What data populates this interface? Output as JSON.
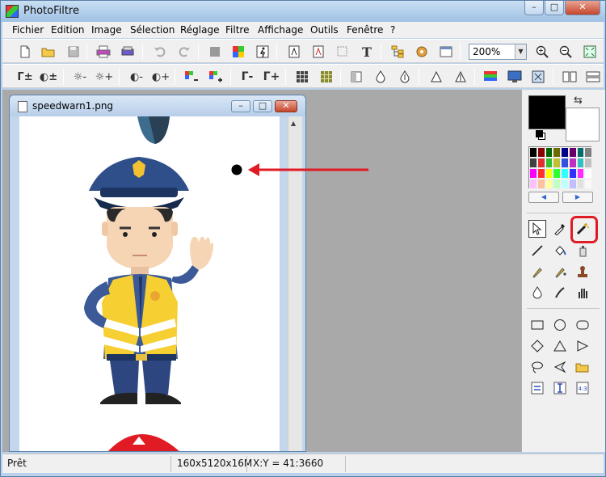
{
  "window": {
    "title": "PhotoFiltre"
  },
  "menu": [
    "Fichier",
    "Edition",
    "Image",
    "Sélection",
    "Réglage",
    "Filtre",
    "Affichage",
    "Outils",
    "Fenêtre",
    "?"
  ],
  "toolbar": {
    "zoom": "200%"
  },
  "document": {
    "title": "speedwarn1.png"
  },
  "status": {
    "state": "Prêt",
    "dims": "160x5120x16M",
    "coords": "X:Y = 41:3660"
  },
  "colors": {
    "accent_red": "#e01b24",
    "foreground": "#000000",
    "background": "#ffffff"
  }
}
